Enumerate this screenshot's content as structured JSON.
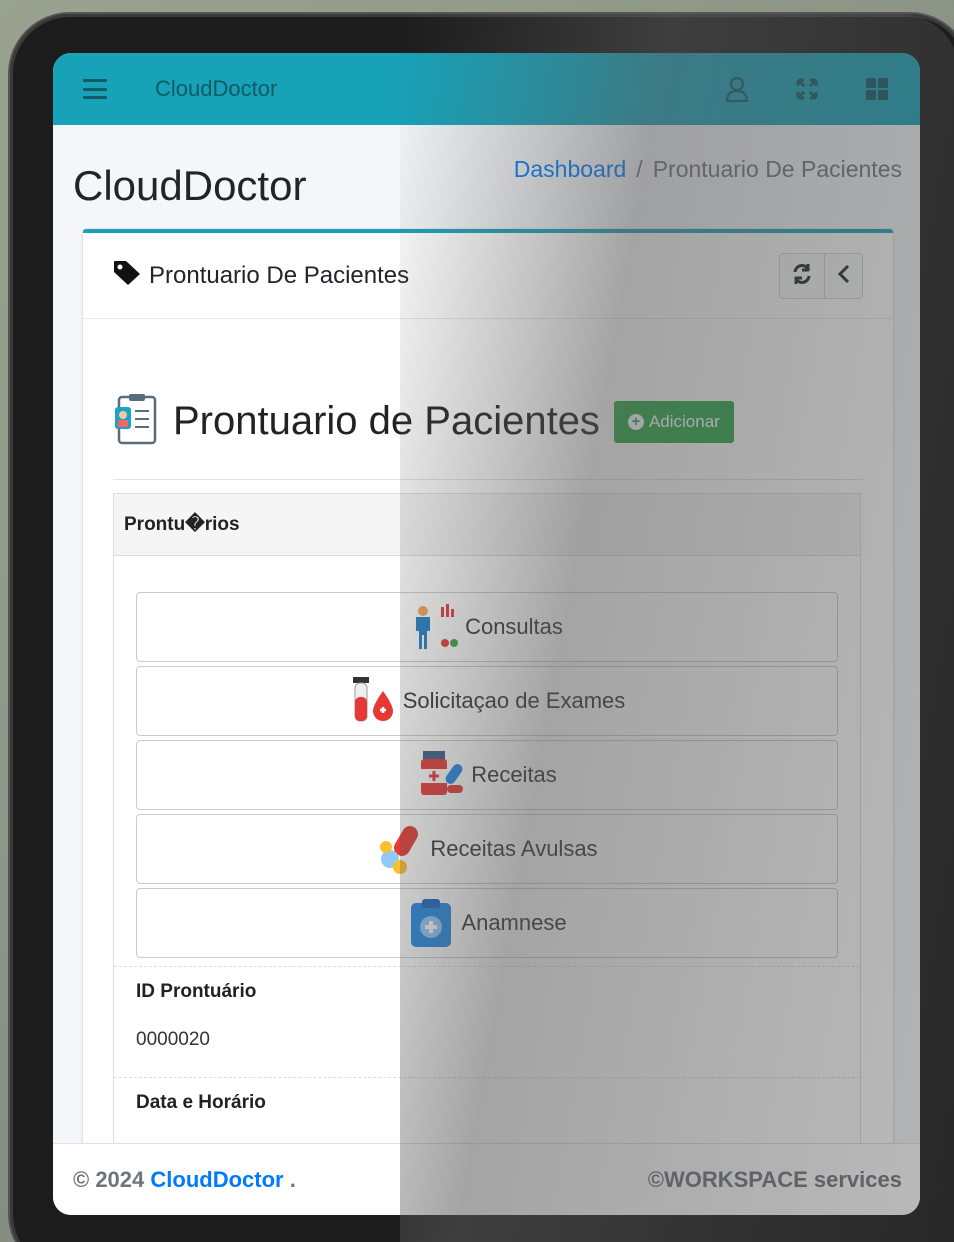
{
  "navbar": {
    "brand": "CloudDoctor",
    "icons": [
      "menu-icon",
      "user-icon",
      "fullscreen-icon",
      "apps-grid-icon"
    ]
  },
  "header": {
    "title": "CloudDoctor",
    "breadcrumb": {
      "home": "Dashboard",
      "separator": "/",
      "current": "Prontuario De Pacientes"
    }
  },
  "card": {
    "title": "Prontuario De Pacientes",
    "section_title": "Prontuario de Pacientes",
    "add_button": "Adicionar",
    "panel_heading": "Prontu�rios",
    "buttons": [
      {
        "label": "Consultas",
        "icon": "doctor-consult-icon"
      },
      {
        "label": "Solicitaçao de Exames",
        "icon": "blood-test-icon"
      },
      {
        "label": "Receitas",
        "icon": "medicine-icon"
      },
      {
        "label": "Receitas Avulsas",
        "icon": "pills-icon"
      },
      {
        "label": "Anamnese",
        "icon": "clipboard-medical-icon"
      }
    ],
    "fields": [
      {
        "label": "ID Prontuário",
        "value": "0000020"
      },
      {
        "label": "Data e Horário",
        "value": ""
      }
    ]
  },
  "footer": {
    "copyright": "© 2024",
    "brand": "CloudDoctor",
    "dot": ".",
    "right": "©WORKSPACE services"
  },
  "colors": {
    "primary": "#17a2b8",
    "success": "#28a745",
    "link": "#007bff"
  }
}
